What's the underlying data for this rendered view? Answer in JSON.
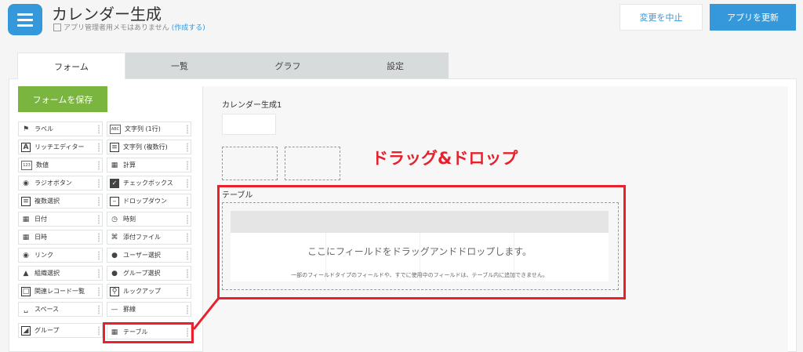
{
  "header": {
    "title": "カレンダー生成",
    "memo": "アプリ管理者用メモはありません",
    "memo_link": "(作成する)",
    "cancel_label": "変更を中止",
    "update_label": "アプリを更新"
  },
  "tabs": [
    "フォーム",
    "一覧",
    "グラフ",
    "設定"
  ],
  "save_label": "フォームを保存",
  "palette": [
    {
      "label": "ラベル",
      "icon": "tag-icon"
    },
    {
      "label": "文字列 (1行)",
      "icon": "text-line-icon"
    },
    {
      "label": "リッチエディター",
      "icon": "rich-editor-icon"
    },
    {
      "label": "文字列 (複数行)",
      "icon": "text-multiline-icon"
    },
    {
      "label": "数値",
      "icon": "number-icon"
    },
    {
      "label": "計算",
      "icon": "calculator-icon"
    },
    {
      "label": "ラジオボタン",
      "icon": "radio-icon"
    },
    {
      "label": "チェックボックス",
      "icon": "checkbox-icon"
    },
    {
      "label": "複数選択",
      "icon": "multi-select-icon"
    },
    {
      "label": "ドロップダウン",
      "icon": "dropdown-icon"
    },
    {
      "label": "日付",
      "icon": "calendar-icon"
    },
    {
      "label": "時刻",
      "icon": "clock-icon"
    },
    {
      "label": "日時",
      "icon": "datetime-icon"
    },
    {
      "label": "添付ファイル",
      "icon": "paperclip-icon"
    },
    {
      "label": "リンク",
      "icon": "globe-icon"
    },
    {
      "label": "ユーザー選択",
      "icon": "user-icon"
    },
    {
      "label": "組織選択",
      "icon": "org-icon"
    },
    {
      "label": "グループ選択",
      "icon": "group-icon"
    },
    {
      "label": "関連レコード一覧",
      "icon": "related-records-icon"
    },
    {
      "label": "ルックアップ",
      "icon": "lookup-icon"
    },
    {
      "label": "スペース",
      "icon": "space-icon"
    },
    {
      "label": "罫線",
      "icon": "rule-line-icon"
    },
    {
      "label": "グループ",
      "icon": "folder-group-icon"
    },
    {
      "label": "テーブル",
      "icon": "table-icon"
    }
  ],
  "canvas": {
    "field_label": "カレンダー生成1",
    "table_label": "テーブル",
    "dnd_text": "ドラッグ&ドロップ",
    "table_message": "ここにフィールドをドラッグアンドドロップします。",
    "table_note": "一部のフィールドタイプのフィールドや、すでに使用中のフィールドは、テーブル内に追加できません。"
  },
  "colors": {
    "accent": "#3498db",
    "save_green": "#7ab53f",
    "highlight_red": "#e8212d"
  }
}
